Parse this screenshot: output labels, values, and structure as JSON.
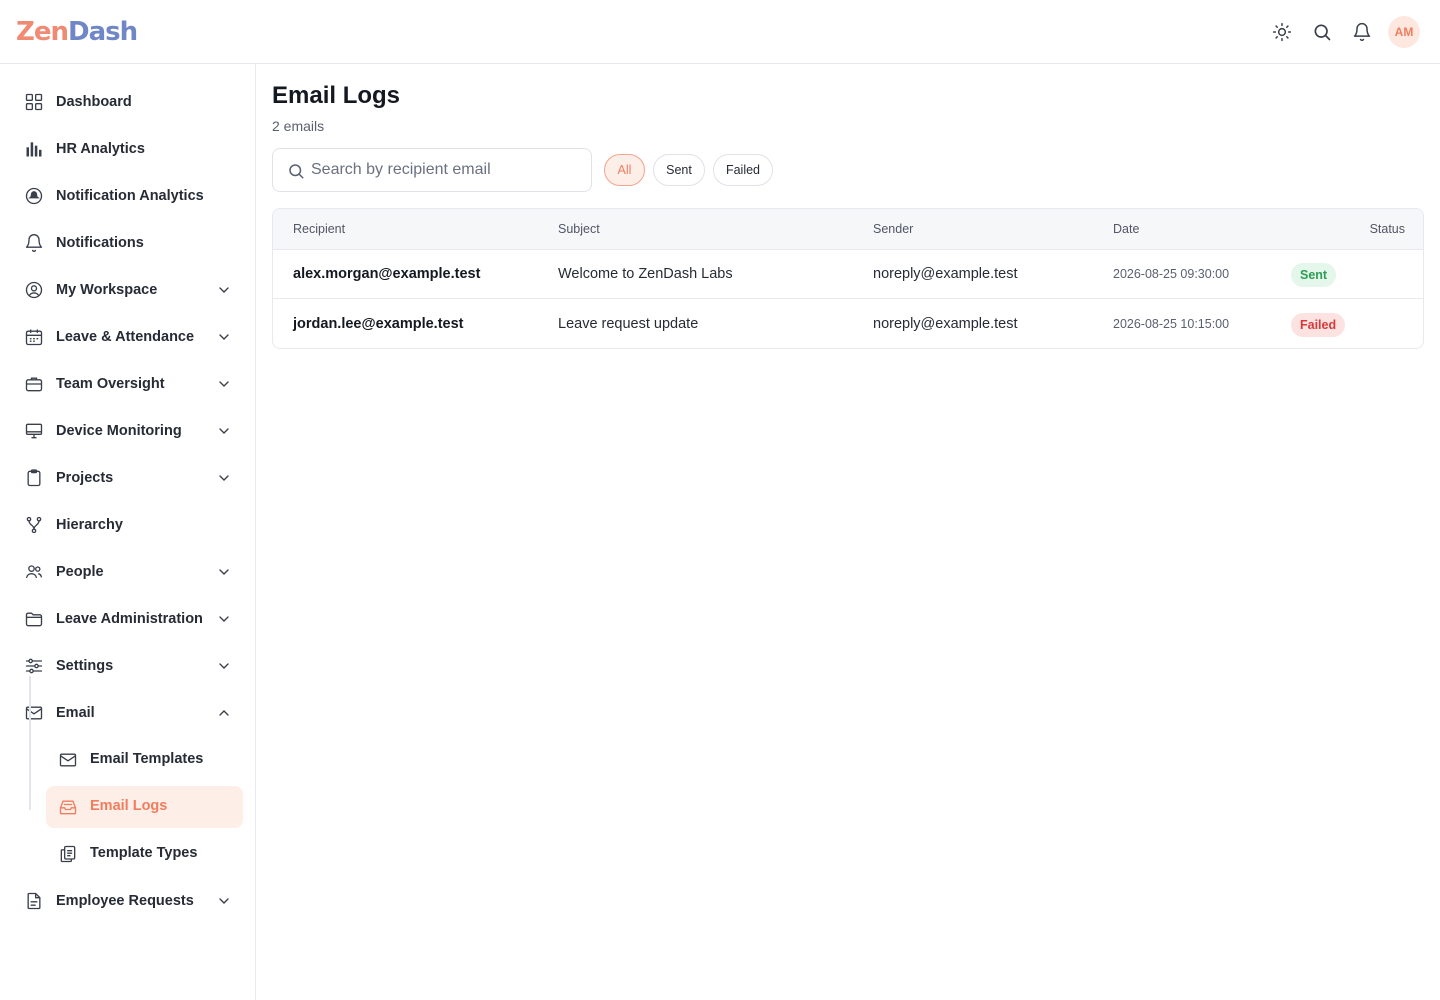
{
  "app": {
    "logo_part1": "Zen",
    "logo_part2": "Dash",
    "avatar_initials": "AM",
    "brand_color": "#ef7d5e"
  },
  "sidebar": {
    "items": [
      {
        "label": "Dashboard",
        "icon": "grid-icon"
      },
      {
        "label": "HR Analytics",
        "icon": "bar-chart-icon"
      },
      {
        "label": "Notification Analytics",
        "icon": "notification-badge-icon"
      },
      {
        "label": "Notifications",
        "icon": "bell-icon"
      },
      {
        "label": "My Workspace",
        "icon": "user-circle-icon"
      },
      {
        "label": "Leave & Attendance",
        "icon": "calendar-icon"
      },
      {
        "label": "Team Oversight",
        "icon": "briefcase-icon"
      },
      {
        "label": "Device Monitoring",
        "icon": "monitor-icon"
      },
      {
        "label": "Projects",
        "icon": "clipboard-icon"
      },
      {
        "label": "Hierarchy",
        "icon": "fork-icon"
      },
      {
        "label": "People",
        "icon": "users-icon"
      },
      {
        "label": "Leave Administration",
        "icon": "folder-icon"
      },
      {
        "label": "Settings",
        "icon": "sliders-icon"
      },
      {
        "label": "Email",
        "icon": "mail-icon"
      },
      {
        "label": "Employee Requests",
        "icon": "document-icon"
      }
    ],
    "email_sub": [
      {
        "label": "Email Templates",
        "icon": "mail-icon"
      },
      {
        "label": "Email Logs",
        "icon": "inbox-icon"
      },
      {
        "label": "Template Types",
        "icon": "copy-icon"
      }
    ]
  },
  "main": {
    "title": "Email Logs",
    "count": "2 emails",
    "search_placeholder": "Search by recipient email",
    "filters": [
      "All",
      "Sent",
      "Failed"
    ],
    "columns": [
      "Recipient",
      "Subject",
      "Sender",
      "Date",
      "Status"
    ],
    "rows": [
      {
        "recipient": "alex.morgan@example.test",
        "subject": "Welcome to ZenDash Labs",
        "sender": "noreply@example.test",
        "date": "2026-08-25 09:30:00",
        "status": "Sent"
      },
      {
        "recipient": "jordan.lee@example.test",
        "subject": "Leave request update",
        "sender": "noreply@example.test",
        "date": "2026-08-25 10:15:00",
        "status": "Failed"
      }
    ]
  }
}
